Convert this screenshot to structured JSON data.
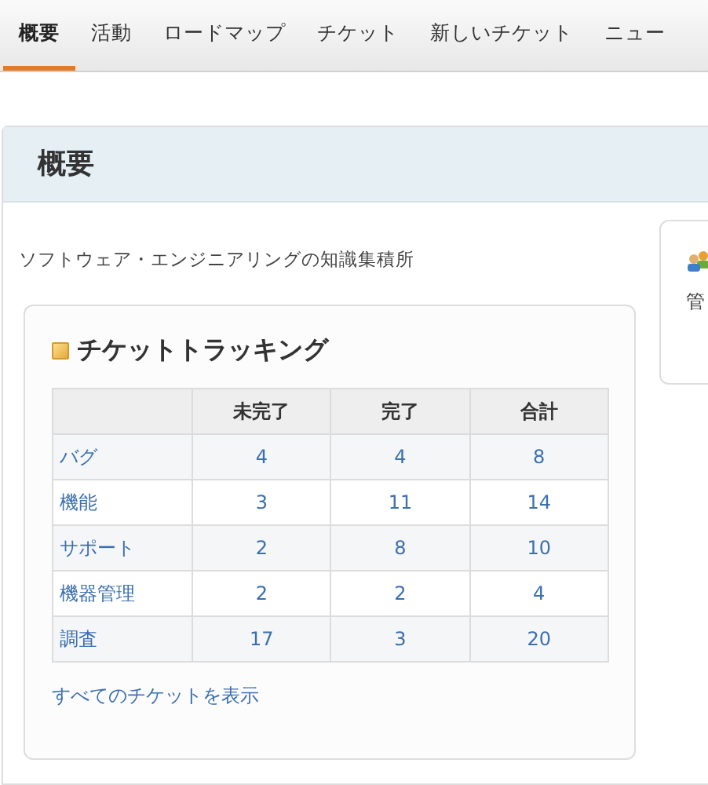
{
  "tabs": [
    {
      "label": "概要",
      "selected": true
    },
    {
      "label": "活動",
      "selected": false
    },
    {
      "label": "ロードマップ",
      "selected": false
    },
    {
      "label": "チケット",
      "selected": false
    },
    {
      "label": "新しいチケット",
      "selected": false
    },
    {
      "label": "ニュー",
      "selected": false
    }
  ],
  "page_title": "概要",
  "description": "ソフトウェア・エンジニアリングの知識集積所",
  "ticket_tracking": {
    "title": "チケットトラッキング",
    "columns": [
      "",
      "未完了",
      "完了",
      "合計"
    ],
    "rows": [
      {
        "name": "バグ",
        "open": "4",
        "closed": "4",
        "total": "8"
      },
      {
        "name": "機能",
        "open": "3",
        "closed": "11",
        "total": "14"
      },
      {
        "name": "サポート",
        "open": "2",
        "closed": "8",
        "total": "10"
      },
      {
        "name": "機器管理",
        "open": "2",
        "closed": "2",
        "total": "4"
      },
      {
        "name": "調査",
        "open": "17",
        "closed": "3",
        "total": "20"
      }
    ],
    "view_all_link": "すべてのチケットを表示"
  },
  "members_box": {
    "text": "管"
  }
}
